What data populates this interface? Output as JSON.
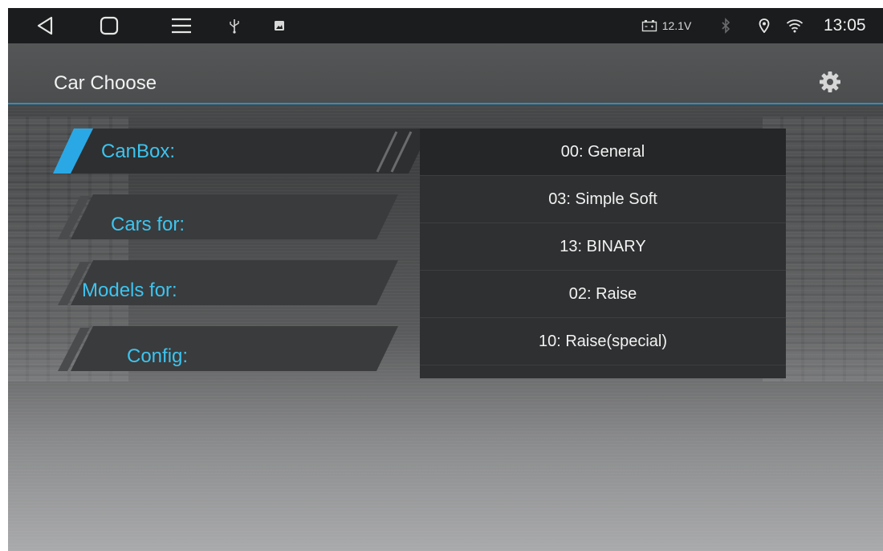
{
  "status_bar": {
    "nav_back_icon": "back-triangle-icon",
    "nav_home_icon": "home-square-icon",
    "nav_menu_icon": "menu-lines-icon",
    "usb_icon": "usb-icon",
    "image_icon": "image-notification-icon",
    "battery_voltage": "12.1V",
    "bluetooth_icon": "bluetooth-icon",
    "location_icon": "location-pin-icon",
    "wifi_icon": "wifi-icon",
    "time": "13:05"
  },
  "header": {
    "title": "Car Choose",
    "settings_icon": "gear-icon"
  },
  "menu": {
    "items": [
      {
        "label": "CanBox:",
        "selected": true
      },
      {
        "label": "Cars for:",
        "selected": false
      },
      {
        "label": "Models for:",
        "selected": false
      },
      {
        "label": "Config:",
        "selected": false
      }
    ]
  },
  "canbox_list": {
    "items": [
      {
        "label": "00: General",
        "selected": true
      },
      {
        "label": "03: Simple Soft",
        "selected": false
      },
      {
        "label": "13: BINARY",
        "selected": false
      },
      {
        "label": "02: Raise",
        "selected": false
      },
      {
        "label": "10: Raise(special)",
        "selected": false
      }
    ]
  },
  "colors": {
    "accent": "#3cc4f0",
    "header_line": "#2f8fbf",
    "status_bar_bg": "#1b1c1d",
    "list_bg": "#2f3031"
  }
}
